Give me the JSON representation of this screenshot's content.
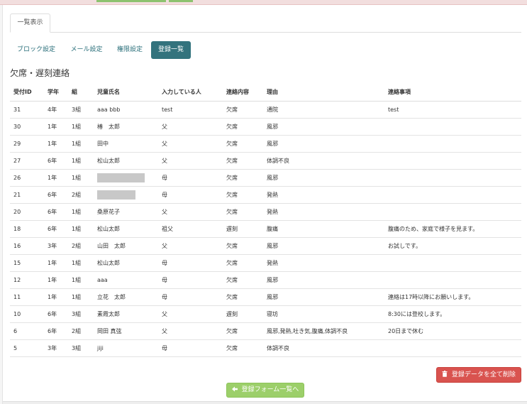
{
  "top_tab": {
    "label": "一覧表示"
  },
  "sub_tabs": [
    {
      "label": "ブロック設定"
    },
    {
      "label": "メール設定"
    },
    {
      "label": "権限設定"
    },
    {
      "label": "登録一覧"
    }
  ],
  "section_title": "欠席・遅刻連絡",
  "table": {
    "headers": [
      "受付ID",
      "学年",
      "組",
      "児童氏名",
      "入力している人",
      "連絡内容",
      "理由",
      "連絡事項"
    ],
    "rows": [
      {
        "id": "31",
        "grade": "4年",
        "class": "3組",
        "name": "aaa bbb",
        "reporter": "test",
        "type": "欠席",
        "reason": "通院",
        "note": "test"
      },
      {
        "id": "30",
        "grade": "1年",
        "class": "1組",
        "name": "椿　太郎",
        "reporter": "父",
        "type": "欠席",
        "reason": "風邪",
        "note": ""
      },
      {
        "id": "29",
        "grade": "1年",
        "class": "1組",
        "name": "田中",
        "reporter": "父",
        "type": "欠席",
        "reason": "風邪",
        "note": ""
      },
      {
        "id": "27",
        "grade": "6年",
        "class": "1組",
        "name": "松山太郎",
        "reporter": "父",
        "type": "欠席",
        "reason": "体調不良",
        "note": ""
      },
      {
        "id": "26",
        "grade": "1年",
        "class": "1組",
        "name": "",
        "reporter": "母",
        "type": "欠席",
        "reason": "風邪",
        "note": ""
      },
      {
        "id": "21",
        "grade": "6年",
        "class": "2組",
        "name": "",
        "reporter": "母",
        "type": "欠席",
        "reason": "発熱",
        "note": ""
      },
      {
        "id": "20",
        "grade": "6年",
        "class": "1組",
        "name": "桑原花子",
        "reporter": "父",
        "type": "欠席",
        "reason": "発熱",
        "note": ""
      },
      {
        "id": "18",
        "grade": "6年",
        "class": "1組",
        "name": "松山太郎",
        "reporter": "祖父",
        "type": "遅刻",
        "reason": "腹痛",
        "note": "腹痛のため、家庭で様子を見ます。"
      },
      {
        "id": "16",
        "grade": "3年",
        "class": "2組",
        "name": "山田　太郎",
        "reporter": "父",
        "type": "欠席",
        "reason": "風邪",
        "note": "お試しです。"
      },
      {
        "id": "15",
        "grade": "1年",
        "class": "1組",
        "name": "松山太郎",
        "reporter": "母",
        "type": "欠席",
        "reason": "発熱",
        "note": ""
      },
      {
        "id": "12",
        "grade": "1年",
        "class": "1組",
        "name": "aaa",
        "reporter": "母",
        "type": "欠席",
        "reason": "風邪",
        "note": ""
      },
      {
        "id": "11",
        "grade": "1年",
        "class": "1組",
        "name": "立花　太郎",
        "reporter": "母",
        "type": "欠席",
        "reason": "風邪",
        "note": "連絡は17時以降にお願いします。"
      },
      {
        "id": "10",
        "grade": "6年",
        "class": "3組",
        "name": "素霞太郎",
        "reporter": "父",
        "type": "遅刻",
        "reason": "寝坊",
        "note": "8:30には登校します。"
      },
      {
        "id": "6",
        "grade": "6年",
        "class": "2組",
        "name": "岡田 真弦",
        "reporter": "父",
        "type": "欠席",
        "reason": "風邪,発熱,吐き気,腹痛,体調不良",
        "note": "20日まで休む"
      },
      {
        "id": "5",
        "grade": "3年",
        "class": "3組",
        "name": "jiji",
        "reporter": "母",
        "type": "欠席",
        "reason": "体調不良",
        "note": ""
      }
    ]
  },
  "buttons": {
    "delete_all": "登録データを全て削除",
    "back": "登録フォーム一覧へ"
  },
  "icons": {
    "delete_icon": "trash-icon",
    "back_icon": "arrow-left-icon"
  },
  "colors": {
    "active_tab": "#33737d",
    "delete_button": "#d9534f",
    "back_button": "#9ccf6a",
    "top_band": "#f2dede"
  }
}
